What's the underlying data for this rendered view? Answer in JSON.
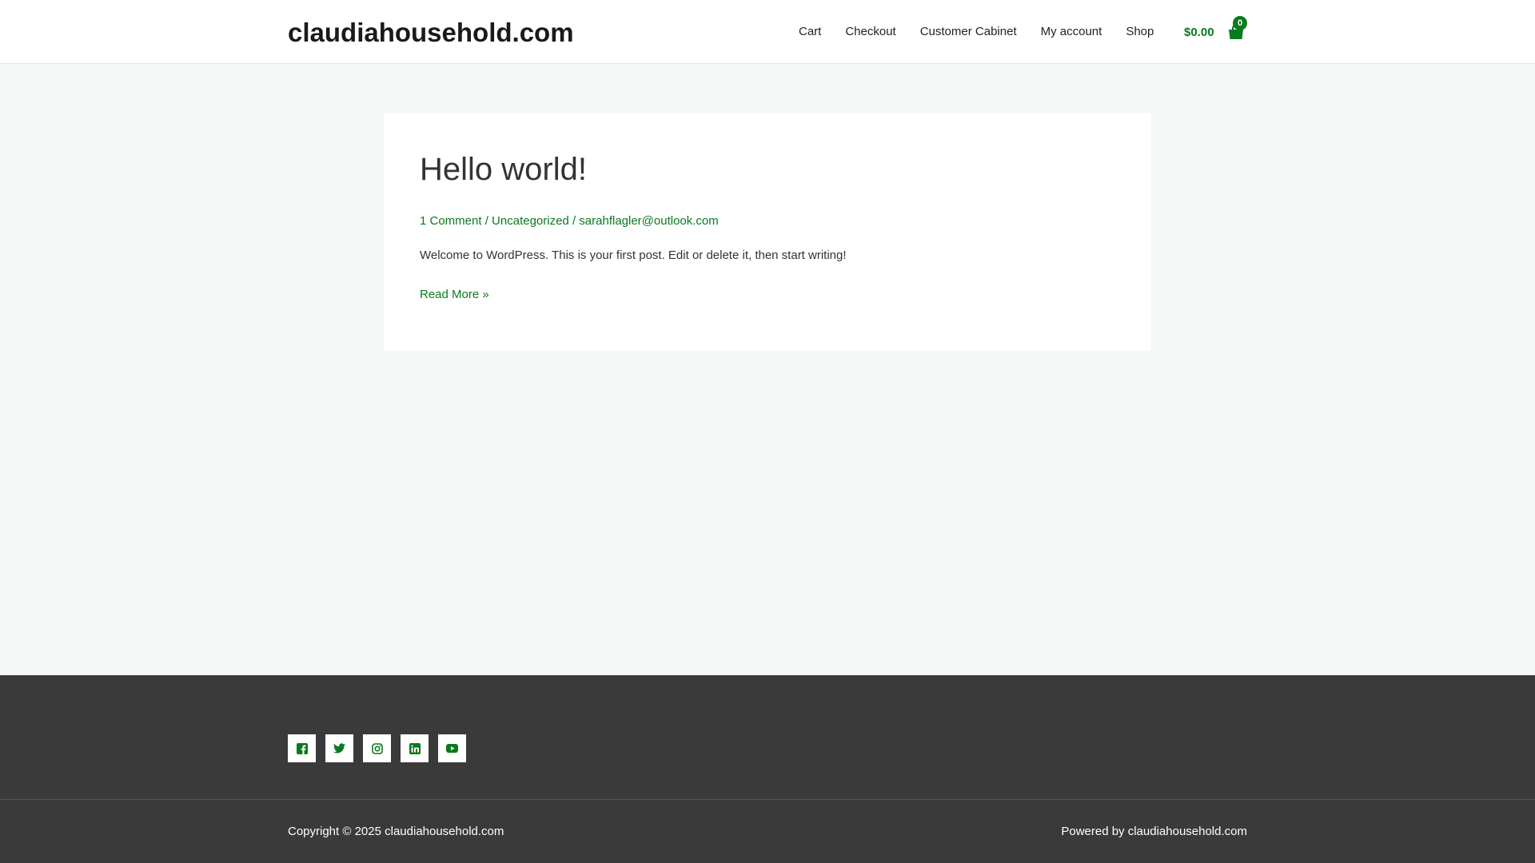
{
  "header": {
    "site_title": "claudiahousehold.com",
    "nav": [
      "Cart",
      "Checkout",
      "Customer Cabinet",
      "My account",
      "Shop"
    ],
    "cart_total": "$0.00",
    "cart_count": "0",
    "cart_icon": "shopping-bag-icon"
  },
  "post": {
    "title": "Hello world!",
    "comments": "1 Comment",
    "separator": " / ",
    "category": "Uncategorized",
    "author": "sarahflagler@outlook.com",
    "excerpt": "Welcome to WordPress. This is your first post. Edit or delete it, then start writing!",
    "read_more": "Read More »"
  },
  "footer": {
    "social_icons": [
      "facebook-icon",
      "twitter-icon",
      "instagram-icon",
      "linkedin-icon",
      "youtube-icon"
    ],
    "copyright": "Copyright © 2025 claudiahousehold.com",
    "powered_by": "Powered by claudiahousehold.com"
  },
  "colors": {
    "accent": "#0a7a1f",
    "footer_bg": "#3a3a3a",
    "page_bg": "#f5f7f6"
  }
}
